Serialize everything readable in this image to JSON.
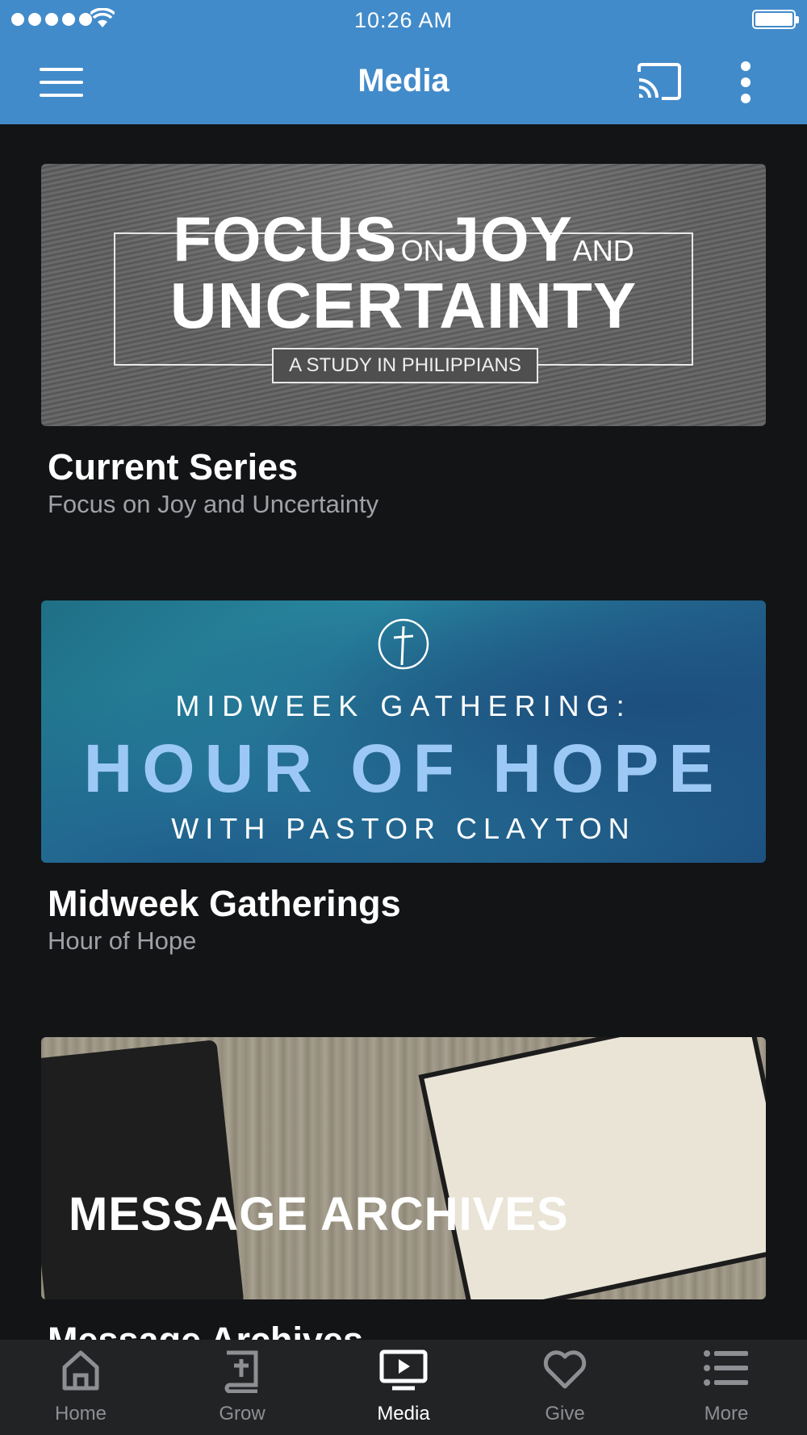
{
  "status_bar": {
    "time": "10:26 AM"
  },
  "app_bar": {
    "title": "Media"
  },
  "cards": [
    {
      "title": "Current Series",
      "subtitle": "Focus on Joy and Uncertainty",
      "banner": {
        "word1": "FOCUS",
        "word2": "ON",
        "word3": "JOY",
        "word4": "AND",
        "line2": "UNCERTAINTY",
        "tagline": "A STUDY IN PHILIPPIANS"
      }
    },
    {
      "title": "Midweek Gatherings",
      "subtitle": "Hour of Hope",
      "banner": {
        "line1": "MIDWEEK GATHERING:",
        "line2": "HOUR OF HOPE",
        "line3": "WITH PASTOR CLAYTON"
      }
    },
    {
      "title": "Message Archives",
      "banner": {
        "text": "MESSAGE ARCHIVES"
      }
    }
  ],
  "tabs": [
    {
      "label": "Home",
      "icon": "home-icon"
    },
    {
      "label": "Grow",
      "icon": "bible-icon"
    },
    {
      "label": "Media",
      "icon": "tv-play-icon",
      "active": true
    },
    {
      "label": "Give",
      "icon": "heart-icon"
    },
    {
      "label": "More",
      "icon": "list-icon"
    }
  ],
  "colors": {
    "header": "#428bca",
    "background": "#131416",
    "tab_bar": "#222325",
    "subtitle": "#9fa1a6"
  }
}
